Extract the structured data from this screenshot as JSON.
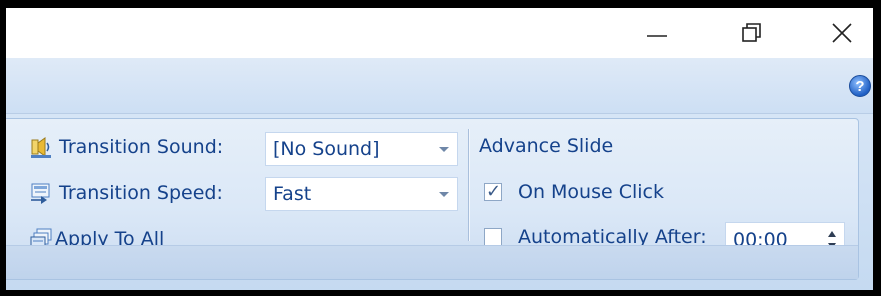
{
  "caption": {
    "minimize": "minimize-icon",
    "restore": "restore-icon",
    "close": "close-icon"
  },
  "help": {
    "glyph": "?",
    "icon": "help-icon"
  },
  "transition": {
    "sound_label": "Transition Sound:",
    "sound_value": "[No Sound]",
    "speed_label": "Transition Speed:",
    "speed_value": "Fast",
    "apply_all_label": "Apply To All"
  },
  "advance": {
    "heading": "Advance Slide",
    "on_click_label": "On Mouse Click",
    "on_click_checked": true,
    "auto_label": "Automatically After:",
    "auto_checked": false,
    "auto_time": "00:00"
  },
  "colors": {
    "label_text": "#15428b",
    "ribbon": "#dbe8f7",
    "tab_strip": "#cddff4"
  }
}
